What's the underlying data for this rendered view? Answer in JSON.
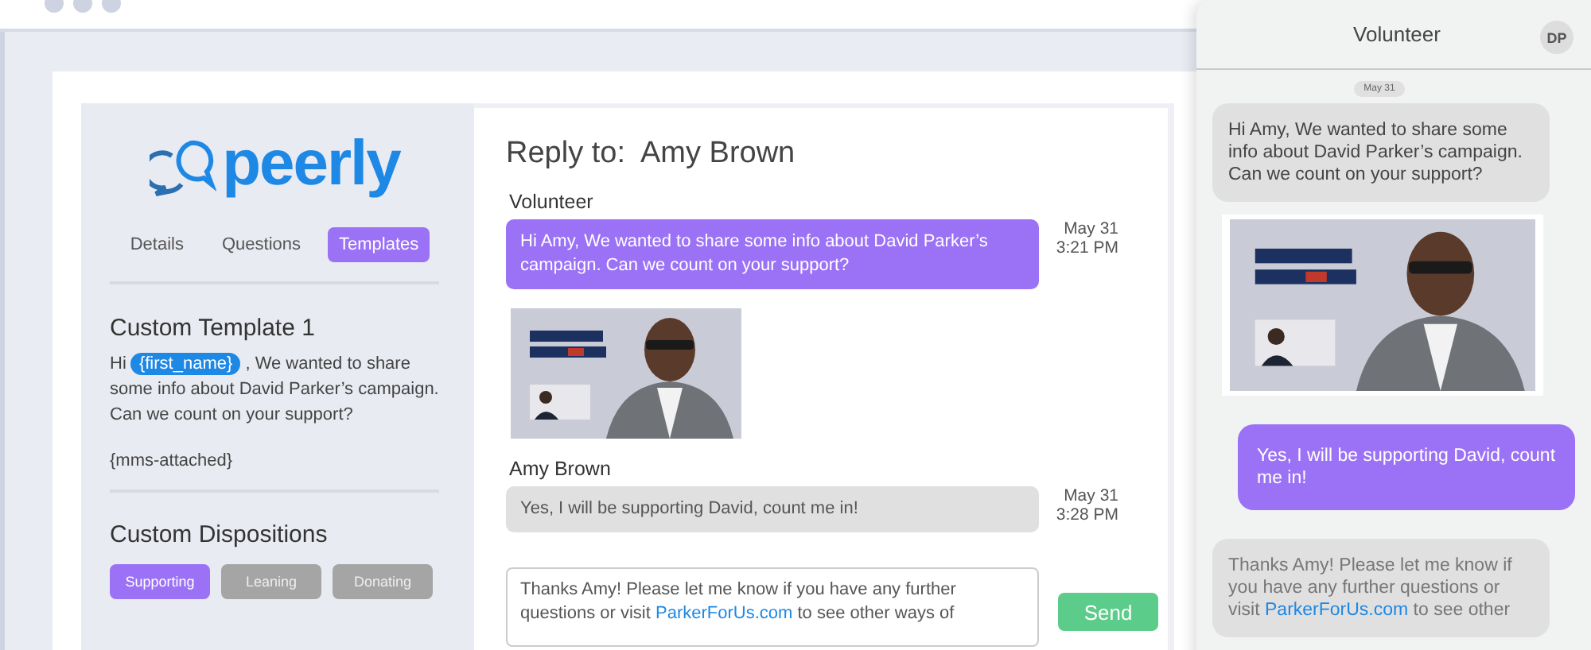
{
  "sidebar": {
    "logo_text": "peerly",
    "tabs": [
      {
        "label": "Details",
        "selected": false
      },
      {
        "label": "Questions",
        "selected": false
      },
      {
        "label": "Templates",
        "selected": true
      }
    ],
    "template": {
      "title": "Custom Template 1",
      "before": "Hi",
      "token": "{first_name}",
      "after": ", We wanted to share some info about David Parker’s campaign. Can we count on your support?",
      "attachment": "{mms-attached}"
    },
    "dispositions_title": "Custom Dispositions",
    "dispositions": [
      {
        "label": "Supporting",
        "selected": true
      },
      {
        "label": "Leaning",
        "selected": false
      },
      {
        "label": "Donating",
        "selected": false
      }
    ]
  },
  "conversation": {
    "title": "Reply to:  Amy Brown",
    "messages": [
      {
        "kind": "outgoing",
        "sender": "Volunteer",
        "text": "Hi Amy, We wanted to share some info about David Parker’s campaign. Can we count on your support?",
        "date": "May 31",
        "time": "3:21 PM"
      },
      {
        "kind": "picture"
      },
      {
        "kind": "incoming",
        "sender": "Amy Brown",
        "text": "Yes, I will be supporting David, count me in!",
        "date": "May 31",
        "time": "3:28 PM"
      }
    ],
    "reply": {
      "before": "Thanks Amy! Please let me know if you have any further questions or visit",
      "link": "ParkerForUs.com",
      "after": "to see other ways of"
    },
    "send_label": "Send"
  },
  "phone": {
    "title": "Volunteer",
    "avatar": "DP",
    "date": "May 31",
    "messages": [
      {
        "kind": "incoming",
        "text": "Hi Amy, We wanted to share some info about David Parker’s campaign. Can we count on your support?"
      },
      {
        "kind": "picture"
      },
      {
        "kind": "outgoing",
        "text": "Yes, I will be supporting David, count me in!"
      },
      {
        "kind": "incoming",
        "before": "Thanks Amy! Please let me know if you have any further questions or visit",
        "link": "ParkerForUs.com",
        "after": "to see other"
      }
    ]
  }
}
